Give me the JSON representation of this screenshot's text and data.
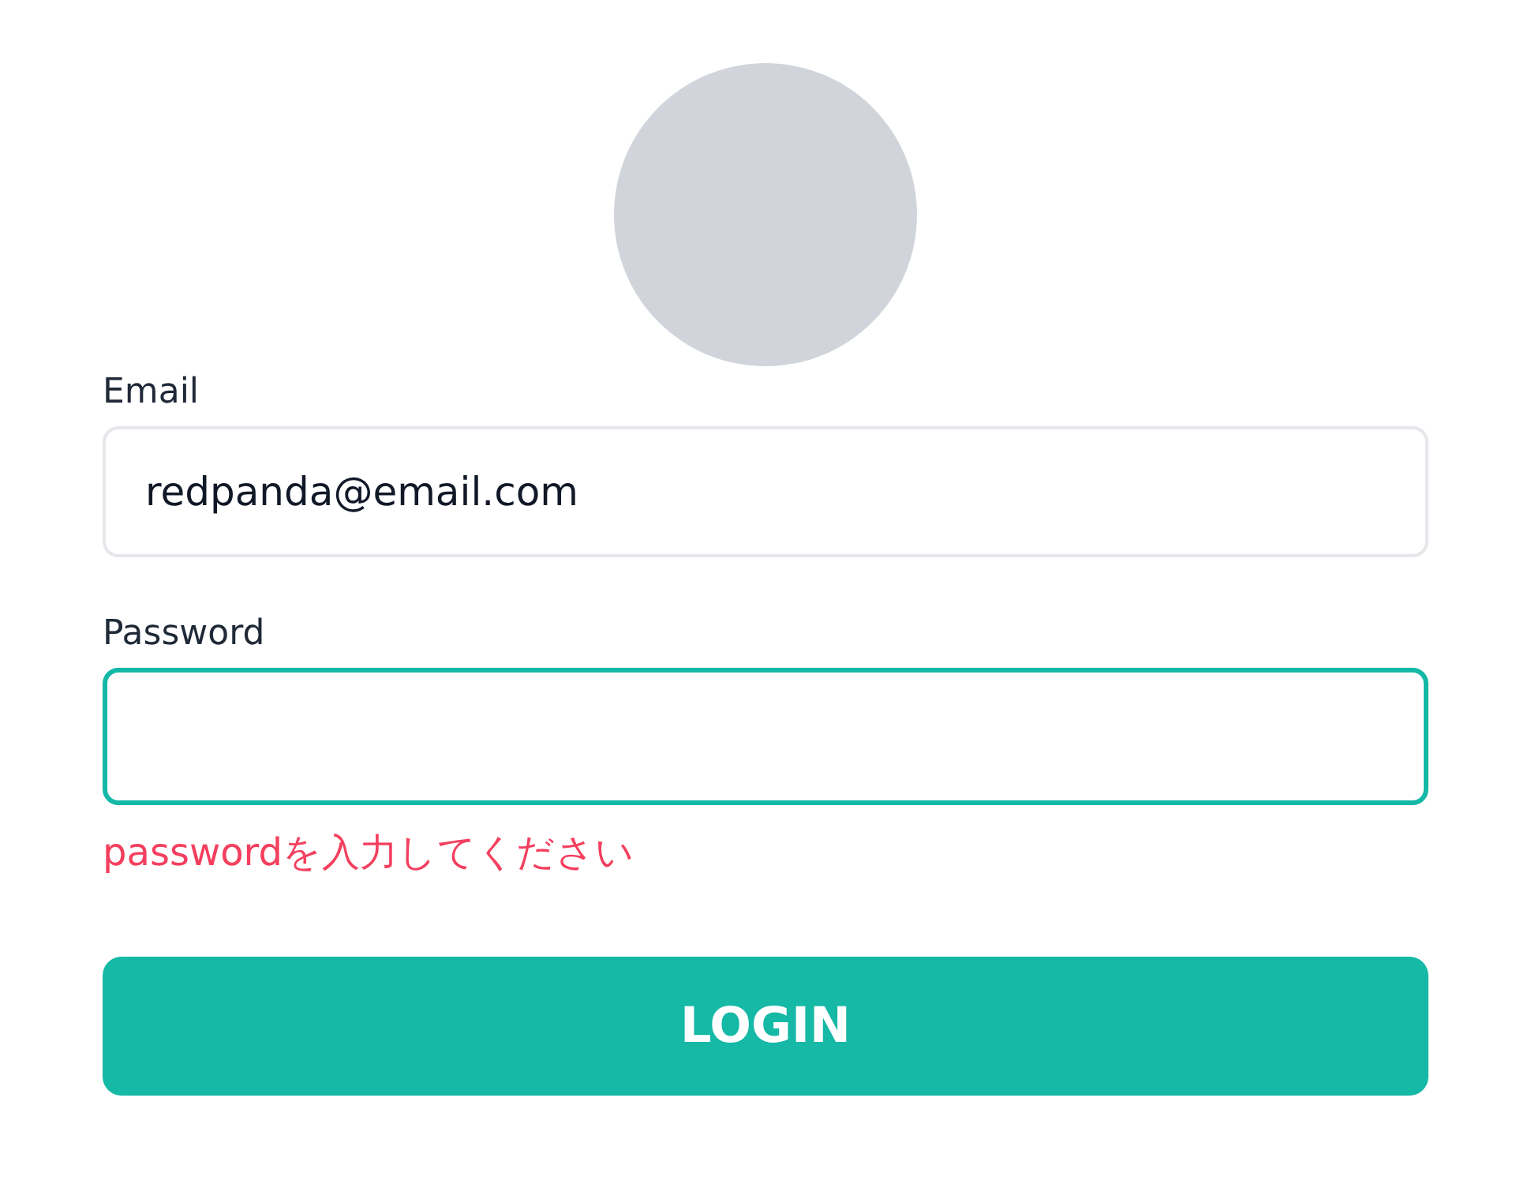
{
  "fields": [
    {
      "label": "Email",
      "value": "redpanda@email.com",
      "focused": false
    },
    {
      "label": "Password",
      "focused": true,
      "error": "passwordを入力してください"
    }
  ],
  "login_button": {
    "label": "LOGIN"
  }
}
